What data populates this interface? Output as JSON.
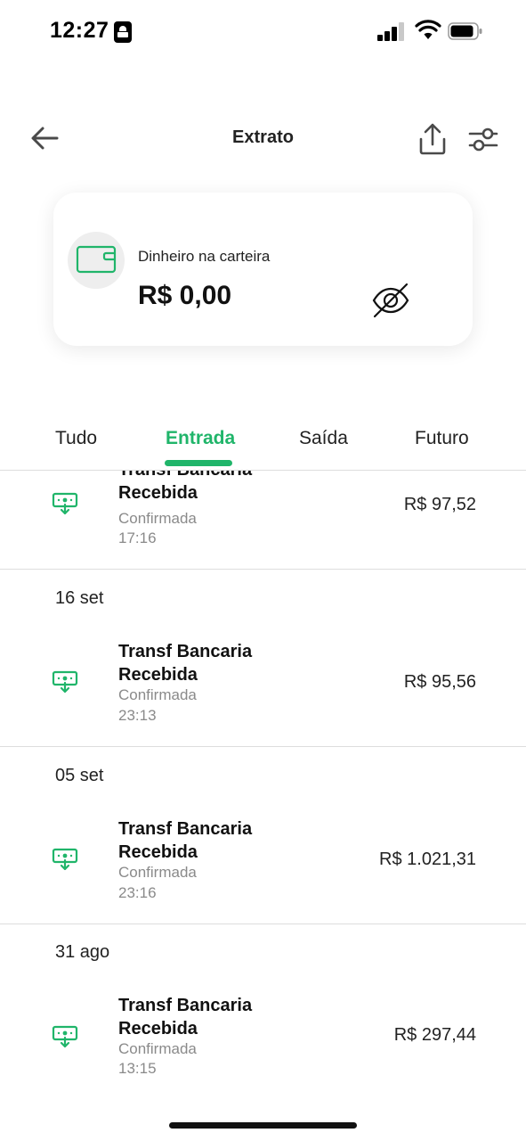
{
  "status_bar": {
    "time": "12:27"
  },
  "header": {
    "title": "Extrato"
  },
  "wallet": {
    "label": "Dinheiro na carteira",
    "balance": "R$ 0,00"
  },
  "tabs": [
    {
      "label": "Tudo",
      "active": false
    },
    {
      "label": "Entrada",
      "active": true
    },
    {
      "label": "Saída",
      "active": false
    },
    {
      "label": "Futuro",
      "active": false
    }
  ],
  "groups": [
    {
      "date": "",
      "transactions": [
        {
          "title": "Transf Bancaria Recebida",
          "status": "Confirmada",
          "time": "17:16",
          "amount": "R$ 97,52"
        }
      ]
    },
    {
      "date": "16 set",
      "transactions": [
        {
          "title": "Transf Bancaria Recebida",
          "status": "Confirmada",
          "time": "23:13",
          "amount": "R$ 95,56"
        }
      ]
    },
    {
      "date": "05 set",
      "transactions": [
        {
          "title": "Transf Bancaria Recebida",
          "status": "Confirmada",
          "time": "23:16",
          "amount": "R$ 1.021,31"
        }
      ]
    },
    {
      "date": "31 ago",
      "transactions": [
        {
          "title": "Transf Bancaria Recebida",
          "status": "Confirmada",
          "time": "13:15",
          "amount": "R$ 297,44"
        }
      ]
    }
  ],
  "icons": {
    "back": "arrow-left-icon",
    "share": "share-icon",
    "filter": "filter-sliders-icon",
    "wallet": "wallet-icon",
    "hide_balance": "eye-off-icon",
    "transaction": "money-receive-icon"
  },
  "colors": {
    "accent": "#20b56a",
    "text": "#111111",
    "muted": "#8a8a8a",
    "divider": "#dddddd"
  }
}
